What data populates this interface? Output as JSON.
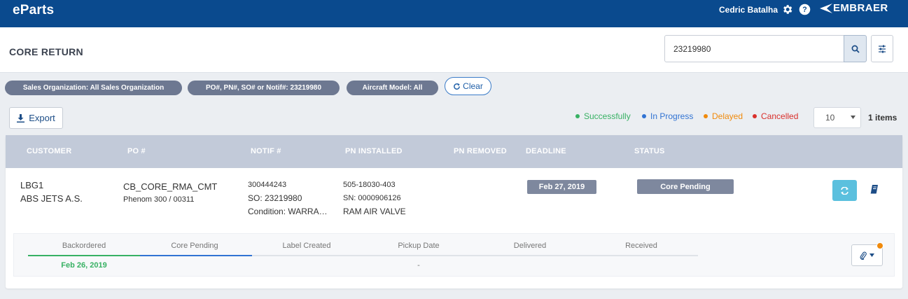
{
  "app": {
    "logo": "eParts",
    "brand": "EMBRAER",
    "user": "Cedric Batalha"
  },
  "header": {
    "title": "CORE RETURN"
  },
  "search": {
    "value": "23219980",
    "icon": "search-icon"
  },
  "filters": {
    "chips": [
      "Sales Organization: All Sales Organization",
      "PO#, PN#, SO# or Notif#: 23219980",
      "Aircraft Model: All"
    ],
    "clear_label": "Clear"
  },
  "toolbar": {
    "export_label": "Export"
  },
  "legend": {
    "items": [
      {
        "label": "Successfully",
        "color": "#37b163"
      },
      {
        "label": "In Progress",
        "color": "#3173d3"
      },
      {
        "label": "Delayed",
        "color": "#f08a0c"
      },
      {
        "label": "Cancelled",
        "color": "#d9302c"
      }
    ]
  },
  "pagination": {
    "page_size": "10",
    "items_count": "1 items"
  },
  "table": {
    "columns": [
      "CUSTOMER",
      "PO #",
      "NOTIF #",
      "PN INSTALLED",
      "PN REMOVED",
      "DEADLINE",
      "STATUS"
    ],
    "row": {
      "customer_code": "LBG1",
      "customer_name": "ABS JETS A.S.",
      "po_number": "CB_CORE_RMA_CMT",
      "po_aircraft": "Phenom 300 / 00311",
      "notif_number": "300444243",
      "so_number": "SO: 23219980",
      "condition": "Condition: WARRA…",
      "pn_installed": "505-18030-403",
      "serial_number": "SN: 0000906126",
      "part_description": "RAM AIR VALVE",
      "deadline": "Feb 27, 2019",
      "status": "Core Pending"
    }
  },
  "timeline": {
    "steps": [
      "Backordered",
      "Core Pending",
      "Label Created",
      "Pickup Date",
      "Delivered",
      "Received"
    ],
    "backordered_date": "Feb 26, 2019",
    "pickup_date": "-"
  },
  "colors": {
    "topbar": "#0a4a8e",
    "accent": "#5bc0de",
    "badge": "#7e889e"
  }
}
